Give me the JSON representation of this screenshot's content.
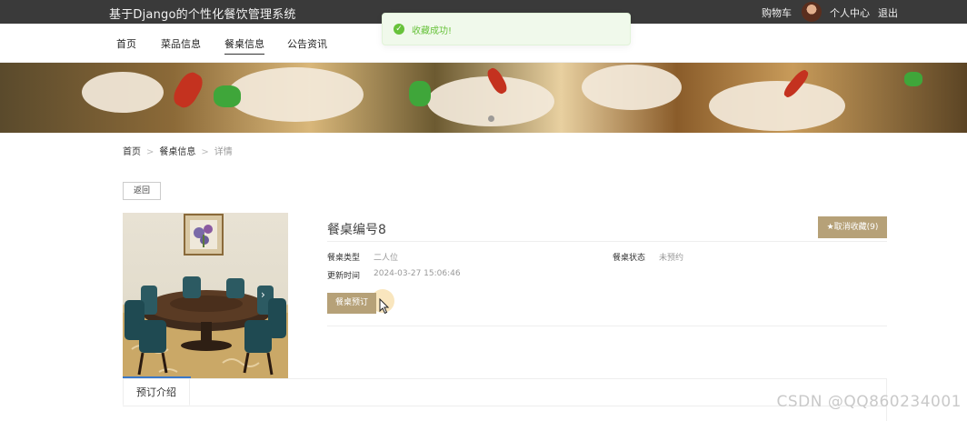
{
  "header": {
    "site_title": "基于Django的个性化餐饮管理系统",
    "cart": "购物车",
    "profile": "个人中心",
    "logout": "退出"
  },
  "toast": {
    "message": "收藏成功!"
  },
  "nav": {
    "items": [
      {
        "label": "首页"
      },
      {
        "label": "菜品信息"
      },
      {
        "label": "餐桌信息",
        "active": true
      },
      {
        "label": "公告资讯"
      }
    ]
  },
  "breadcrumb": {
    "home": "首页",
    "section": "餐桌信息",
    "current": "详情"
  },
  "back_button": "返回",
  "detail": {
    "title": "餐桌编号8",
    "favorite_button": "★取消收藏(9)",
    "table_type_label": "餐桌类型",
    "table_type_value": "二人位",
    "status_label": "餐桌状态",
    "status_value": "未预约",
    "updated_label": "更新时间",
    "updated_value": "2024-03-27 15:06:46",
    "book_button": "餐桌预订"
  },
  "tabs": {
    "active": "预订介绍"
  },
  "watermark": "CSDN @QQ860234001",
  "colors": {
    "accent": "#b6a178",
    "topbar": "#3a3a3a",
    "success": "#67c23a"
  }
}
